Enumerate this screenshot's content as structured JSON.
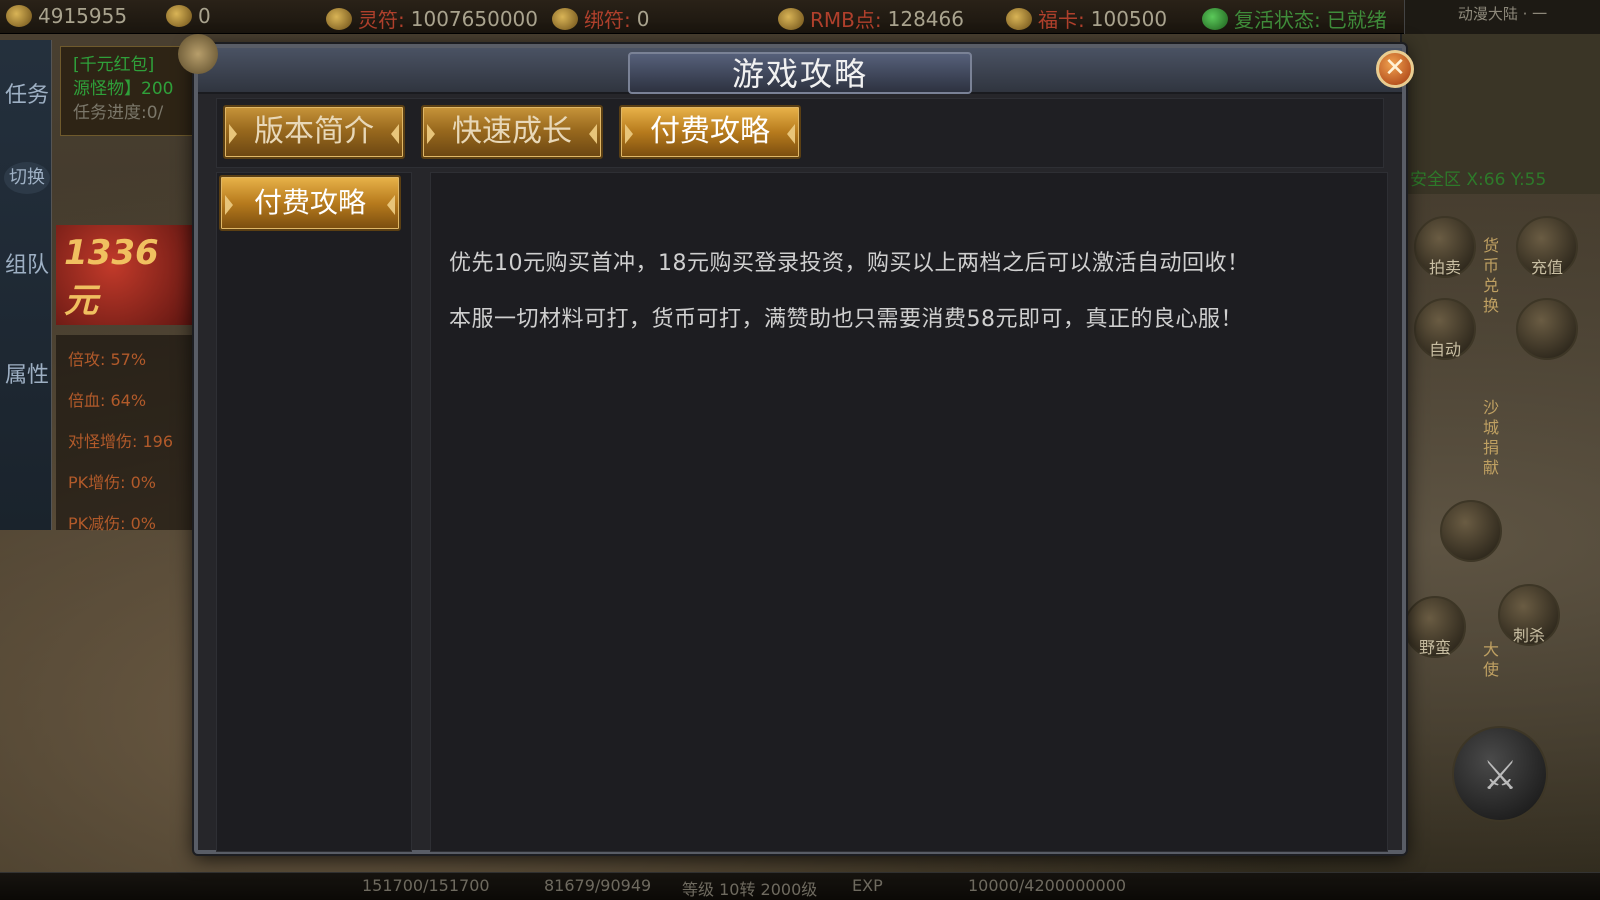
{
  "topbar": {
    "gold": "4915955",
    "ingot": "0",
    "lingfu_label": "灵符:",
    "lingfu_value": "1007650000",
    "bangfu_label": "绑符:",
    "bangfu_value": "0",
    "rmb_label": "RMB点:",
    "rmb_value": "128466",
    "fuka_label": "福卡:",
    "fuka_value": "100500",
    "revive_label": "复活状态:",
    "revive_value": "已就绪",
    "map_name": "动漫大陆 · 一"
  },
  "left_panel": {
    "tab_task": "任务",
    "tab_switch": "切换",
    "tab_team": "组队",
    "tab_attr": "属性",
    "quest_line1": "[千元红包]",
    "quest_line2": "源怪物】200",
    "quest_progress": "任务进度:0/",
    "promo_text": "1336元",
    "stats": [
      "倍攻: 57%",
      "倍血: 64%",
      "对怪增伤: 196",
      "PK增伤: 0%",
      "PK减伤: 0%"
    ]
  },
  "minimap": {
    "zone": "安全区",
    "coords": "X:66 Y:55"
  },
  "right_buttons": {
    "auction": "拍卖",
    "recharge": "充值",
    "auto": "自动",
    "currency_exchange": "货币兑换",
    "sand_donate": "沙城捐献",
    "savage": "野蛮",
    "assassinate": "刺杀",
    "envoy": "大使"
  },
  "bottombar": {
    "hp": "151700/151700",
    "mp": "81679/90949",
    "level_label": "等级",
    "level_value": "10转 2000级",
    "exp_label": "EXP",
    "exp_value": "10000/4200000000"
  },
  "modal": {
    "title": "游戏攻略",
    "tabs": [
      {
        "label": "版本简介",
        "active": false
      },
      {
        "label": "快速成长",
        "active": false
      },
      {
        "label": "付费攻略",
        "active": true
      }
    ],
    "side_items": [
      {
        "label": "付费攻略"
      }
    ],
    "content": {
      "line1": "优先10元购买首冲，18元购买登录投资，购买以上两档之后可以激活自动回收！",
      "line2": "本服一切材料可打，货币可打，满赞助也只需要消费58元即可，真正的良心服！"
    },
    "close_symbol": "✕"
  },
  "colors": {
    "tab_gold": "#b77b1d",
    "panel_bg": "#1d1d21",
    "frame": "#595d66",
    "close_orange": "#d9692a"
  }
}
